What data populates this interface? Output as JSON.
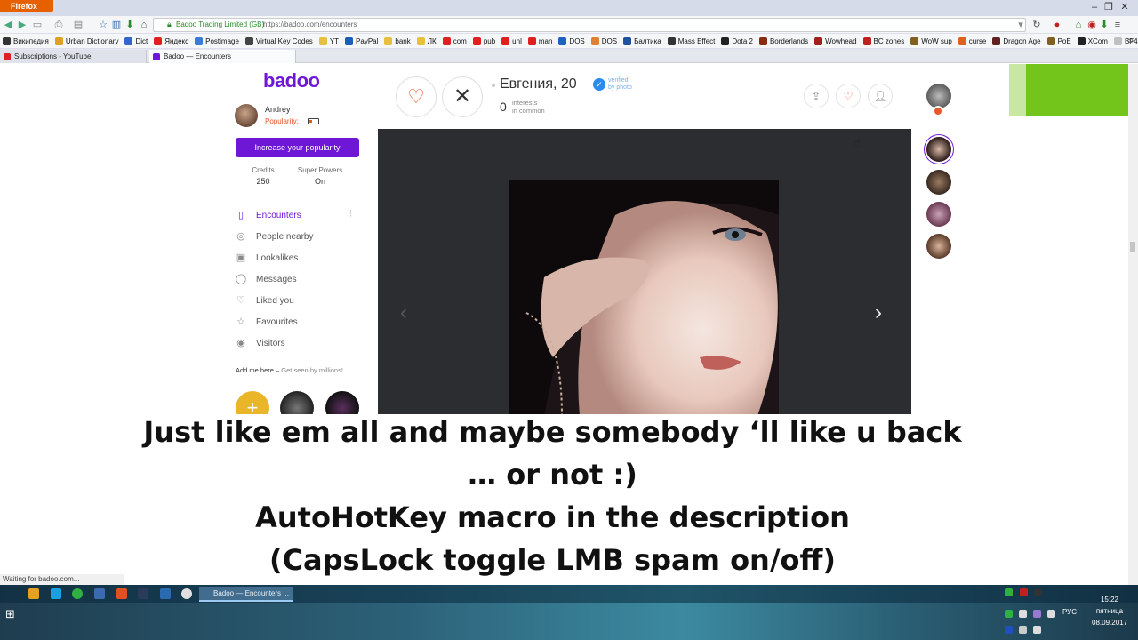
{
  "browser": {
    "menu_label": "Firefox",
    "url_owner": "Badoo Trading Limited (GB)",
    "url": "https://badoo.com/encounters",
    "status_text": "Waiting for badoo.com...",
    "bookmarks": [
      {
        "label": "Википедия",
        "color": "#333333"
      },
      {
        "label": "Urban Dictionary",
        "color": "#e0a020"
      },
      {
        "label": "Dict",
        "color": "#3366cc"
      },
      {
        "label": "Яндекс",
        "color": "#e02020"
      },
      {
        "label": "Postimage",
        "color": "#3a7bd5"
      },
      {
        "label": "Virtual Key Codes",
        "color": "#444444"
      },
      {
        "label": "YT",
        "color": "#e8c040"
      },
      {
        "label": "PayPal",
        "color": "#1a5fb4"
      },
      {
        "label": "bank",
        "color": "#e8c040"
      },
      {
        "label": "ЛК",
        "color": "#e8c040"
      },
      {
        "label": "com",
        "color": "#e02020"
      },
      {
        "label": "pub",
        "color": "#e02020"
      },
      {
        "label": "unl",
        "color": "#e02020"
      },
      {
        "label": "man",
        "color": "#e02020"
      },
      {
        "label": "DOS",
        "color": "#2060c0"
      },
      {
        "label": "DOS",
        "color": "#e08030"
      },
      {
        "label": "Балтика",
        "color": "#2050a0"
      },
      {
        "label": "Mass Effect",
        "color": "#333333"
      },
      {
        "label": "Dota 2",
        "color": "#222222"
      },
      {
        "label": "Borderlands",
        "color": "#8a2a10"
      },
      {
        "label": "Wowhead",
        "color": "#a02020"
      },
      {
        "label": "BC zones",
        "color": "#c02020"
      },
      {
        "label": "WoW sup",
        "color": "#806020"
      },
      {
        "label": "curse",
        "color": "#e06020"
      },
      {
        "label": "Dragon Age",
        "color": "#602020"
      },
      {
        "label": "PoE",
        "color": "#806020"
      },
      {
        "label": "XCom",
        "color": "#222222"
      },
      {
        "label": "BF4",
        "color": "#c0c0c0"
      }
    ],
    "tabs": [
      {
        "label": "Subscriptions - YouTube",
        "color": "#e02020"
      },
      {
        "label": "Badoo — Encounters",
        "color": "#6e17d6"
      }
    ]
  },
  "sidebar": {
    "logo": "badoo",
    "user_name": "Andrey",
    "popularity_label": "Popularity:",
    "boost_button": "Increase your popularity",
    "credits_label": "Credits",
    "credits_value": "250",
    "superpowers_label": "Super Powers",
    "superpowers_value": "On",
    "menu": [
      {
        "label": "Encounters",
        "icon": "encounters-icon",
        "glyph": "▯",
        "active": true
      },
      {
        "label": "People nearby",
        "icon": "globe-icon",
        "glyph": "◎",
        "active": false
      },
      {
        "label": "Lookalikes",
        "icon": "lookalikes-icon",
        "glyph": "▣",
        "active": false
      },
      {
        "label": "Messages",
        "icon": "chat-bubble-icon",
        "glyph": "◯",
        "active": false
      },
      {
        "label": "Liked you",
        "icon": "heart-icon",
        "glyph": "♡",
        "active": false
      },
      {
        "label": "Favourites",
        "icon": "star-icon",
        "glyph": "☆",
        "active": false
      },
      {
        "label": "Visitors",
        "icon": "eye-icon",
        "glyph": "◉",
        "active": false
      }
    ],
    "add_me_label": "Add me here –",
    "add_me_sub": "Get seen by millions!"
  },
  "profile": {
    "name": "Евгения, 20",
    "verified_line1": "verified",
    "verified_line2": "by photo",
    "common_count": "0",
    "common_line1": "interests",
    "common_line2": "in common"
  },
  "caption": {
    "line1": "Just like em all and maybe somebody ‘ll like u back",
    "line2": "… or not :)",
    "line3": "AutoHotKey macro in the description",
    "line4": "(CapsLock toggle LMB spam on/off)"
  },
  "taskbar": {
    "task_label": "Badoo — Encounters ...",
    "lang": "РУС",
    "time": "15:22",
    "day": "пятница",
    "date": "08.09.2017"
  },
  "colors": {
    "brand": "#6e17d6",
    "like": "#e8562a",
    "verified": "#2a8cf0"
  }
}
